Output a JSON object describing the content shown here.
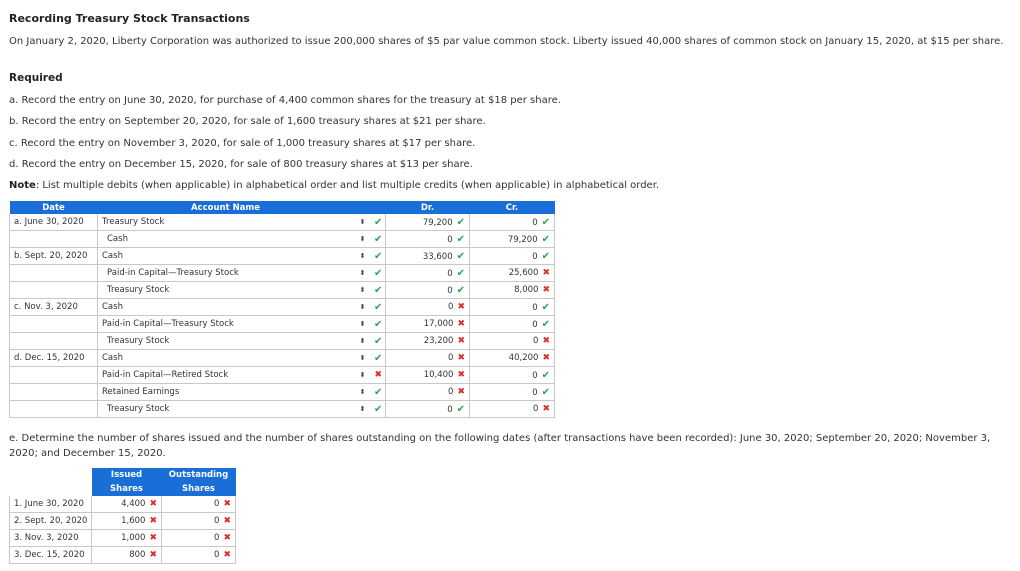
{
  "title": "Recording Treasury Stock Transactions",
  "intro": "On January 2, 2020, Liberty Corporation was authorized to issue 200,000 shares of $5 par value common stock. Liberty issued 40,000 shares of common stock on January 15, 2020, at $15 per share.",
  "required_label": "Required",
  "requirements": [
    "a. Record the entry on June 30, 2020, for purchase of 4,400 common shares for the treasury at $18 per share.",
    "b. Record the entry on September 20, 2020, for sale of 1,600 treasury shares at $21 per share.",
    "c. Record the entry on November 3, 2020, for sale of 1,000 treasury shares at $17 per share.",
    "d. Record the entry on December 15, 2020, for sale of 800 treasury shares at $13 per share."
  ],
  "note_label": "Note",
  "note_text": ": List multiple debits (when applicable) in alphabetical order and list multiple credits (when applicable) in alphabetical order.",
  "journal": {
    "headers": {
      "date": "Date",
      "account": "Account Name",
      "dr": "Dr.",
      "cr": "Cr."
    },
    "rows": [
      {
        "date": "a.  June 30, 2020",
        "account": "Treasury Stock",
        "indent": false,
        "acct_ok": true,
        "dr": "79,200",
        "dr_ok": true,
        "cr": "0",
        "cr_ok": true
      },
      {
        "date": "",
        "account": "Cash",
        "indent": true,
        "acct_ok": true,
        "dr": "0",
        "dr_ok": true,
        "cr": "79,200",
        "cr_ok": true
      },
      {
        "date": "b.  Sept. 20, 2020",
        "account": "Cash",
        "indent": false,
        "acct_ok": true,
        "dr": "33,600",
        "dr_ok": true,
        "cr": "0",
        "cr_ok": true
      },
      {
        "date": "",
        "account": "Paid-in Capital—Treasury Stock",
        "indent": true,
        "acct_ok": true,
        "dr": "0",
        "dr_ok": true,
        "cr": "25,600",
        "cr_ok": false
      },
      {
        "date": "",
        "account": "Treasury Stock",
        "indent": true,
        "acct_ok": true,
        "dr": "0",
        "dr_ok": true,
        "cr": "8,000",
        "cr_ok": false
      },
      {
        "date": "c.  Nov. 3, 2020",
        "account": "Cash",
        "indent": false,
        "acct_ok": true,
        "dr": "0",
        "dr_ok": false,
        "cr": "0",
        "cr_ok": true
      },
      {
        "date": "",
        "account": "Paid-in Capital—Treasury Stock",
        "indent": false,
        "acct_ok": true,
        "dr": "17,000",
        "dr_ok": false,
        "cr": "0",
        "cr_ok": true
      },
      {
        "date": "",
        "account": "Treasury Stock",
        "indent": true,
        "acct_ok": true,
        "dr": "23,200",
        "dr_ok": false,
        "cr": "0",
        "cr_ok": false
      },
      {
        "date": "d.  Dec. 15, 2020",
        "account": "Cash",
        "indent": false,
        "acct_ok": true,
        "dr": "0",
        "dr_ok": false,
        "cr": "40,200",
        "cr_ok": false
      },
      {
        "date": "",
        "account": "Paid-in Capital—Retired Stock",
        "indent": false,
        "acct_ok": false,
        "dr": "10,400",
        "dr_ok": false,
        "cr": "0",
        "cr_ok": true
      },
      {
        "date": "",
        "account": "Retained Earnings",
        "indent": false,
        "acct_ok": true,
        "dr": "0",
        "dr_ok": false,
        "cr": "0",
        "cr_ok": true
      },
      {
        "date": "",
        "account": "Treasury Stock",
        "indent": true,
        "acct_ok": true,
        "dr": "0",
        "dr_ok": true,
        "cr": "0",
        "cr_ok": false
      }
    ]
  },
  "part_e": "e. Determine the number of shares issued and the number of shares outstanding on the following dates (after transactions have been recorded): June 30, 2020; September 20, 2020; November 3, 2020; and December 15, 2020.",
  "shares": {
    "headers": {
      "issued_line1": "Issued",
      "issued_line2": "Shares",
      "outstanding_line1": "Outstanding",
      "outstanding_line2": "Shares"
    },
    "rows": [
      {
        "label": "1. June 30, 2020",
        "issued": "4,400",
        "issued_ok": false,
        "outstanding": "0",
        "outstanding_ok": false
      },
      {
        "label": "2. Sept. 20, 2020",
        "issued": "1,600",
        "issued_ok": false,
        "outstanding": "0",
        "outstanding_ok": false
      },
      {
        "label": "3. Nov. 3, 2020",
        "issued": "1,000",
        "issued_ok": false,
        "outstanding": "0",
        "outstanding_ok": false
      },
      {
        "label": "3. Dec. 15, 2020",
        "issued": "800",
        "issued_ok": false,
        "outstanding": "0",
        "outstanding_ok": false
      }
    ]
  },
  "icons": {
    "select_arrow": "⬍",
    "check": "✔",
    "cross": "✖"
  },
  "colors": {
    "header_bg": "#1a6ed8",
    "ok": "#2ea44f",
    "bad": "#d9302c"
  }
}
